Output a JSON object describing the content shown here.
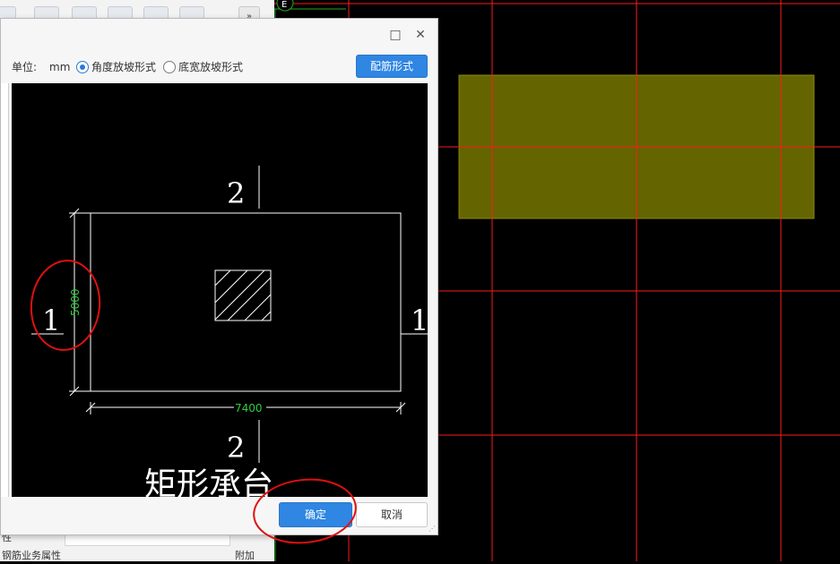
{
  "toolbar": {
    "buttons": [
      "",
      "",
      "",
      "",
      "",
      ""
    ],
    "more": "»"
  },
  "bottom_props": {
    "row1_label": "性",
    "row2_label": "钢筋业务属性",
    "row2_right": "附加"
  },
  "cad": {
    "axis_label": "E",
    "grid_color": "#ff1a1a",
    "slab_color": "#646400"
  },
  "dialog": {
    "unit_label": "单位:",
    "unit_value": "mm",
    "option_angle": "角度放坡形式",
    "option_width": "底宽放坡形式",
    "selected_option": "角度放坡形式",
    "rebar_button": "配筋形式",
    "ok_button": "确定",
    "cancel_button": "取消",
    "window_controls": {
      "maximize": "□",
      "close": "✕"
    }
  },
  "preview": {
    "section_top": "2",
    "section_bottom": "2",
    "section_left": "1",
    "section_right": "1",
    "dim_height": "5000",
    "dim_width": "7400",
    "caption": "矩形承台",
    "dim_color": "#2ecc40",
    "annotation_color": "#e01010"
  }
}
